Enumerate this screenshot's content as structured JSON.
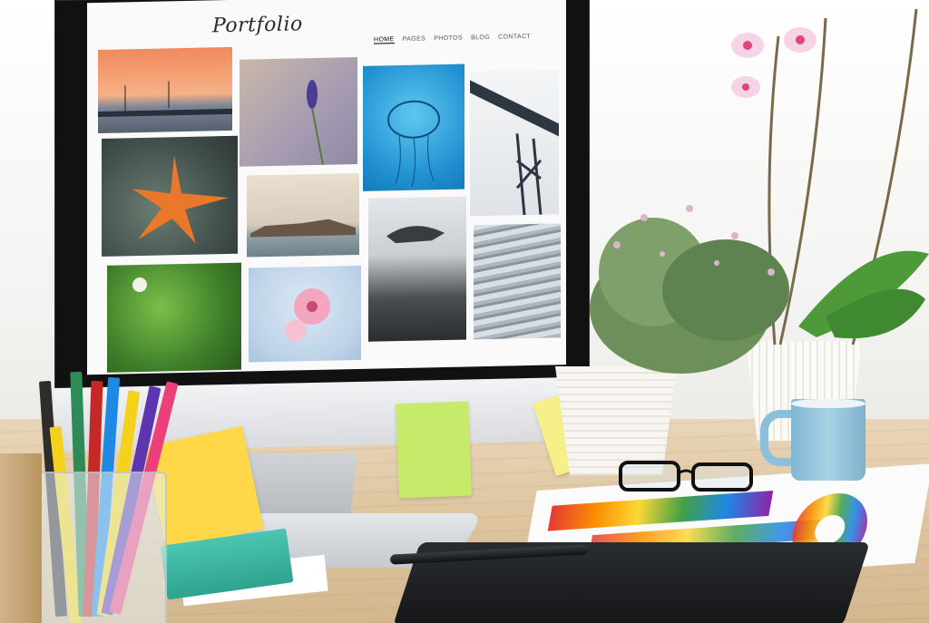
{
  "website": {
    "logo": "Portfolio",
    "nav": [
      "HOME",
      "PAGES",
      "PHOTOS",
      "BLOG",
      "CONTACT"
    ],
    "active_nav": "HOME"
  },
  "colors": {
    "screen_bg": "#fafafa",
    "bezel": "#111111",
    "sticky_yellow": "#ffd84a",
    "sticky_green": "#c6ea6a",
    "sticky_light": "#f5f08a",
    "mug_blue": "#8cbfd9"
  },
  "gallery": [
    {
      "name": "harbor-sunset-photo"
    },
    {
      "name": "lavender-flower-photo"
    },
    {
      "name": "jellyfish-photo"
    },
    {
      "name": "steel-structure-photo"
    },
    {
      "name": "starfish-photo"
    },
    {
      "name": "coastal-town-photo"
    },
    {
      "name": "misty-village-photo"
    },
    {
      "name": "sea-waves-photo"
    },
    {
      "name": "green-leaves-photo"
    },
    {
      "name": "pink-blossom-photo"
    }
  ]
}
